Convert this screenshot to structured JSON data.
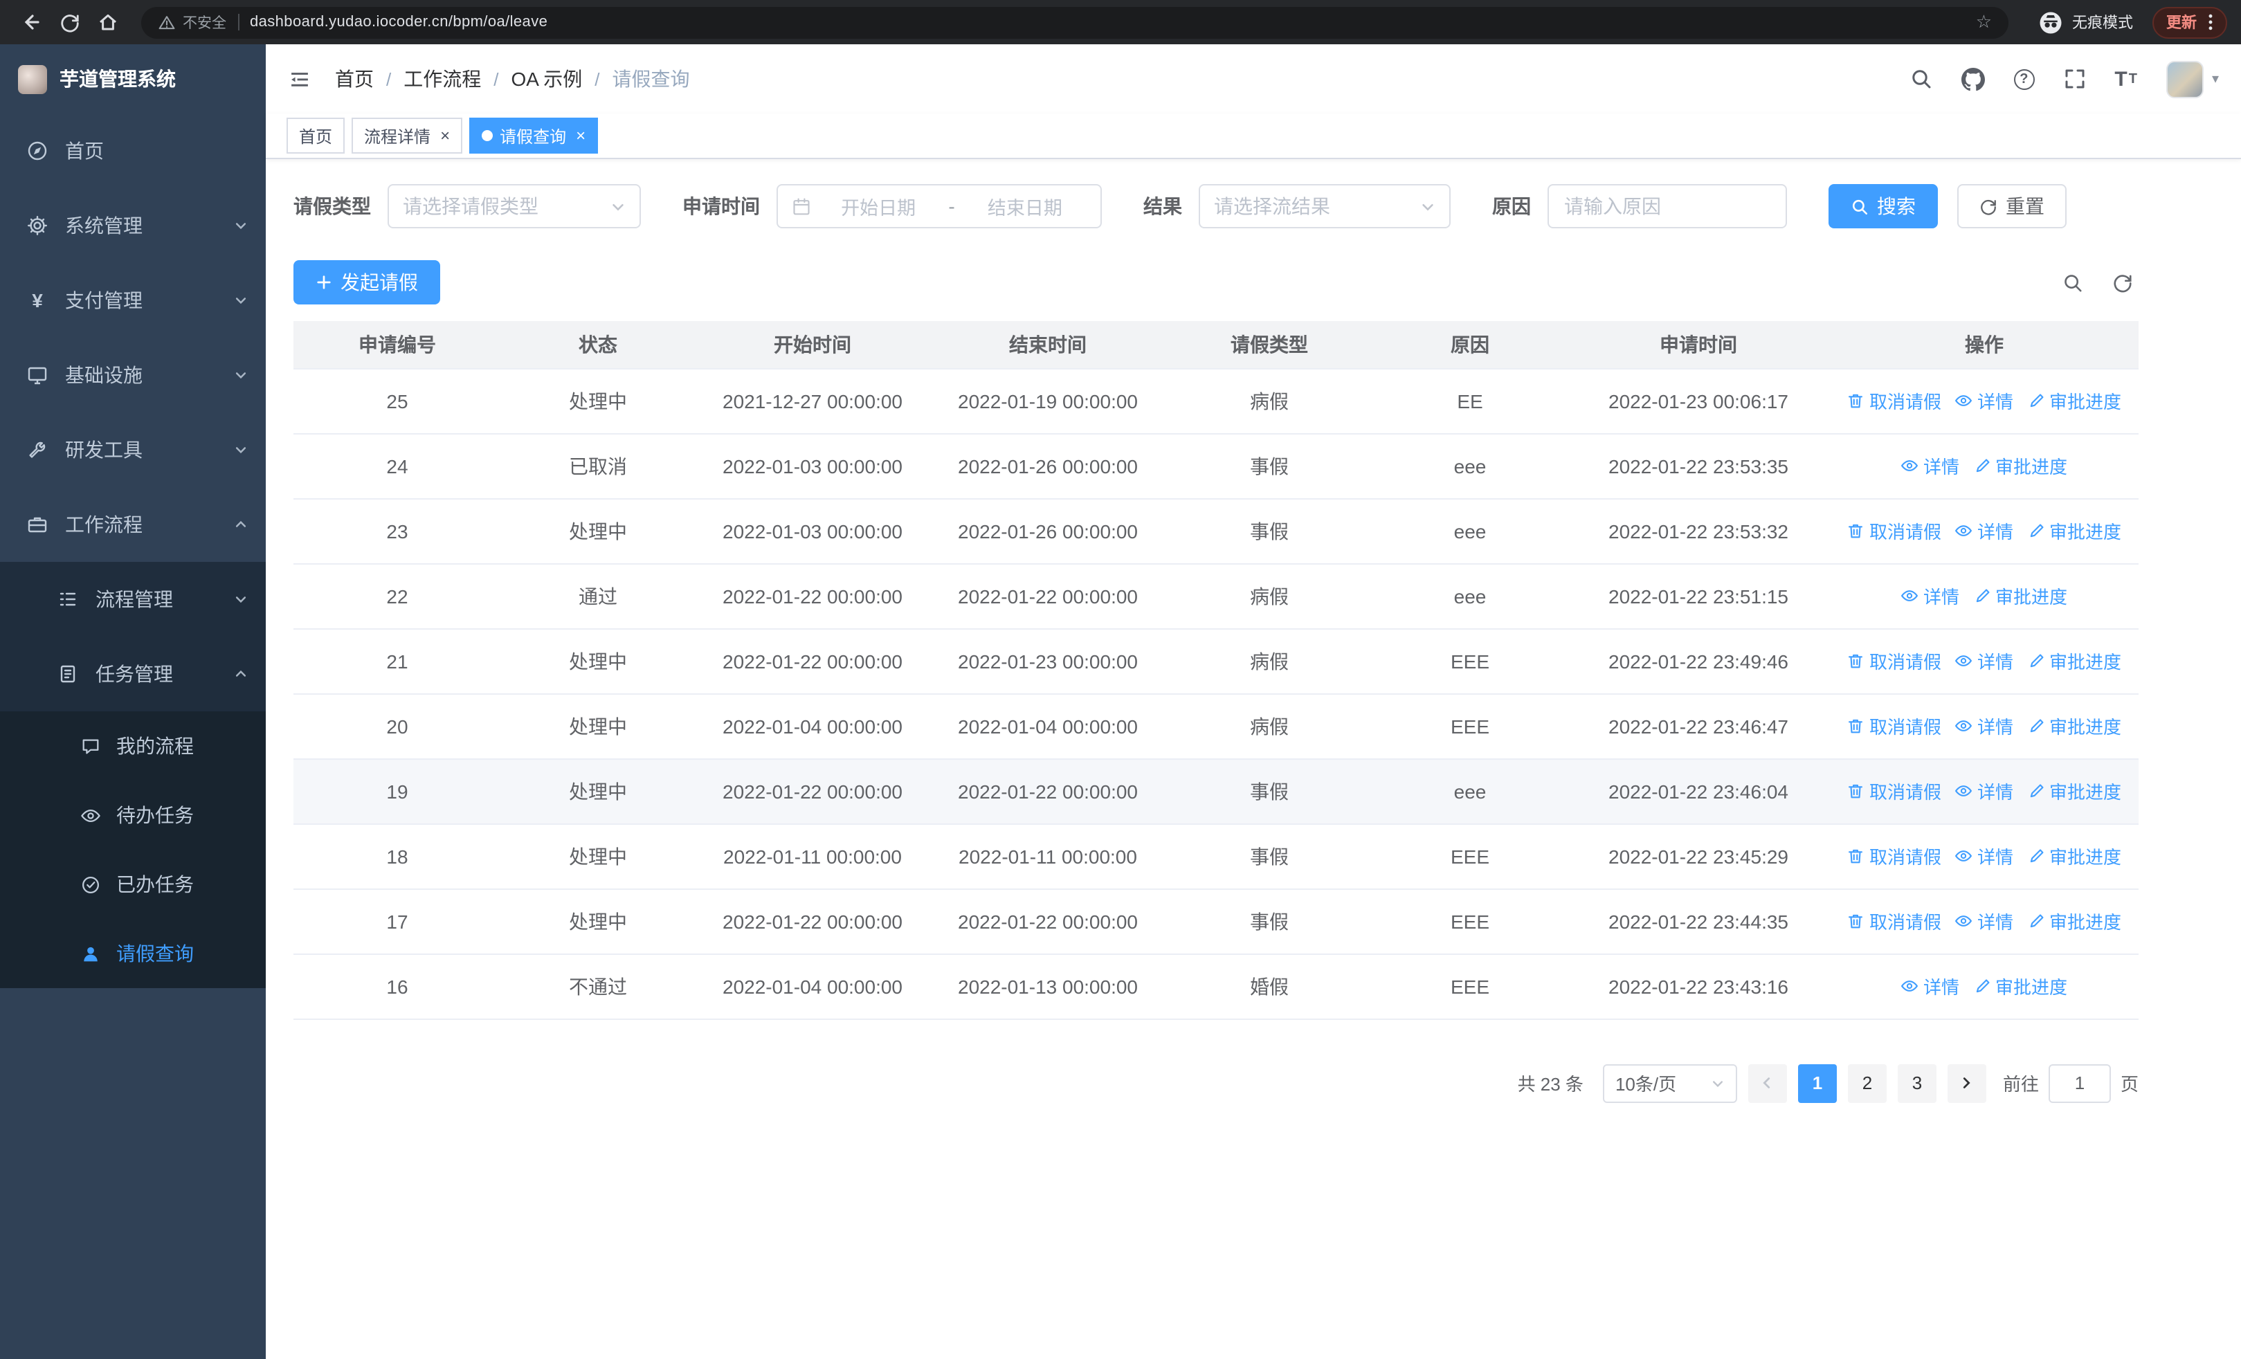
{
  "browser": {
    "security_label": "不安全",
    "url": "dashboard.yudao.iocoder.cn/bpm/oa/leave",
    "incognito_label": "无痕模式",
    "update_label": "更新"
  },
  "sidebar": {
    "app_title": "芋道管理系统",
    "menu": [
      {
        "label": "首页"
      },
      {
        "label": "系统管理"
      },
      {
        "label": "支付管理"
      },
      {
        "label": "基础设施"
      },
      {
        "label": "研发工具"
      },
      {
        "label": "工作流程"
      }
    ],
    "workflow_children": [
      {
        "label": "流程管理"
      },
      {
        "label": "任务管理"
      }
    ],
    "task_children": [
      {
        "label": "我的流程"
      },
      {
        "label": "待办任务"
      },
      {
        "label": "已办任务"
      },
      {
        "label": "请假查询"
      }
    ]
  },
  "navbar": {
    "breadcrumb": [
      "首页",
      "工作流程",
      "OA 示例",
      "请假查询"
    ]
  },
  "tabs": [
    {
      "label": "首页"
    },
    {
      "label": "流程详情"
    },
    {
      "label": "请假查询"
    }
  ],
  "filters": {
    "leave_type_label": "请假类型",
    "leave_type_placeholder": "请选择请假类型",
    "apply_time_label": "申请时间",
    "start_date_placeholder": "开始日期",
    "range_separator": "-",
    "end_date_placeholder": "结束日期",
    "result_label": "结果",
    "result_placeholder": "请选择流结果",
    "reason_label": "原因",
    "reason_placeholder": "请输入原因",
    "search_label": "搜索",
    "reset_label": "重置"
  },
  "toolbar": {
    "create_label": "发起请假"
  },
  "table": {
    "columns": [
      "申请编号",
      "状态",
      "开始时间",
      "结束时间",
      "请假类型",
      "原因",
      "申请时间",
      "操作"
    ],
    "action_labels": {
      "cancel": "取消请假",
      "detail": "详情",
      "progress": "审批进度"
    },
    "rows": [
      {
        "id": "25",
        "status": "处理中",
        "start": "2021-12-27 00:00:00",
        "end": "2022-01-19 00:00:00",
        "type": "病假",
        "reason": "EE",
        "applied": "2022-01-23 00:06:17",
        "actions": [
          "cancel",
          "detail",
          "progress"
        ],
        "highlighted": false
      },
      {
        "id": "24",
        "status": "已取消",
        "start": "2022-01-03 00:00:00",
        "end": "2022-01-26 00:00:00",
        "type": "事假",
        "reason": "eee",
        "applied": "2022-01-22 23:53:35",
        "actions": [
          "detail",
          "progress"
        ],
        "highlighted": false
      },
      {
        "id": "23",
        "status": "处理中",
        "start": "2022-01-03 00:00:00",
        "end": "2022-01-26 00:00:00",
        "type": "事假",
        "reason": "eee",
        "applied": "2022-01-22 23:53:32",
        "actions": [
          "cancel",
          "detail",
          "progress"
        ],
        "highlighted": false
      },
      {
        "id": "22",
        "status": "通过",
        "start": "2022-01-22 00:00:00",
        "end": "2022-01-22 00:00:00",
        "type": "病假",
        "reason": "eee",
        "applied": "2022-01-22 23:51:15",
        "actions": [
          "detail",
          "progress"
        ],
        "highlighted": false
      },
      {
        "id": "21",
        "status": "处理中",
        "start": "2022-01-22 00:00:00",
        "end": "2022-01-23 00:00:00",
        "type": "病假",
        "reason": "EEE",
        "applied": "2022-01-22 23:49:46",
        "actions": [
          "cancel",
          "detail",
          "progress"
        ],
        "highlighted": false
      },
      {
        "id": "20",
        "status": "处理中",
        "start": "2022-01-04 00:00:00",
        "end": "2022-01-04 00:00:00",
        "type": "病假",
        "reason": "EEE",
        "applied": "2022-01-22 23:46:47",
        "actions": [
          "cancel",
          "detail",
          "progress"
        ],
        "highlighted": false
      },
      {
        "id": "19",
        "status": "处理中",
        "start": "2022-01-22 00:00:00",
        "end": "2022-01-22 00:00:00",
        "type": "事假",
        "reason": "eee",
        "applied": "2022-01-22 23:46:04",
        "actions": [
          "cancel",
          "detail",
          "progress"
        ],
        "highlighted": true
      },
      {
        "id": "18",
        "status": "处理中",
        "start": "2022-01-11 00:00:00",
        "end": "2022-01-11 00:00:00",
        "type": "事假",
        "reason": "EEE",
        "applied": "2022-01-22 23:45:29",
        "actions": [
          "cancel",
          "detail",
          "progress"
        ],
        "highlighted": false
      },
      {
        "id": "17",
        "status": "处理中",
        "start": "2022-01-22 00:00:00",
        "end": "2022-01-22 00:00:00",
        "type": "事假",
        "reason": "EEE",
        "applied": "2022-01-22 23:44:35",
        "actions": [
          "cancel",
          "detail",
          "progress"
        ],
        "highlighted": false
      },
      {
        "id": "16",
        "status": "不通过",
        "start": "2022-01-04 00:00:00",
        "end": "2022-01-13 00:00:00",
        "type": "婚假",
        "reason": "EEE",
        "applied": "2022-01-22 23:43:16",
        "actions": [
          "detail",
          "progress"
        ],
        "highlighted": false
      }
    ]
  },
  "pagination": {
    "total_label": "共 23 条",
    "page_size_label": "10条/页",
    "pages": [
      "1",
      "2",
      "3"
    ],
    "active_page": "1",
    "goto_label": "前往",
    "goto_value": "1",
    "page_unit_label": "页"
  },
  "colors": {
    "primary": "#409eff",
    "sidebar_bg": "#304156",
    "sidebar_sub_bg": "#1f2d3d"
  }
}
